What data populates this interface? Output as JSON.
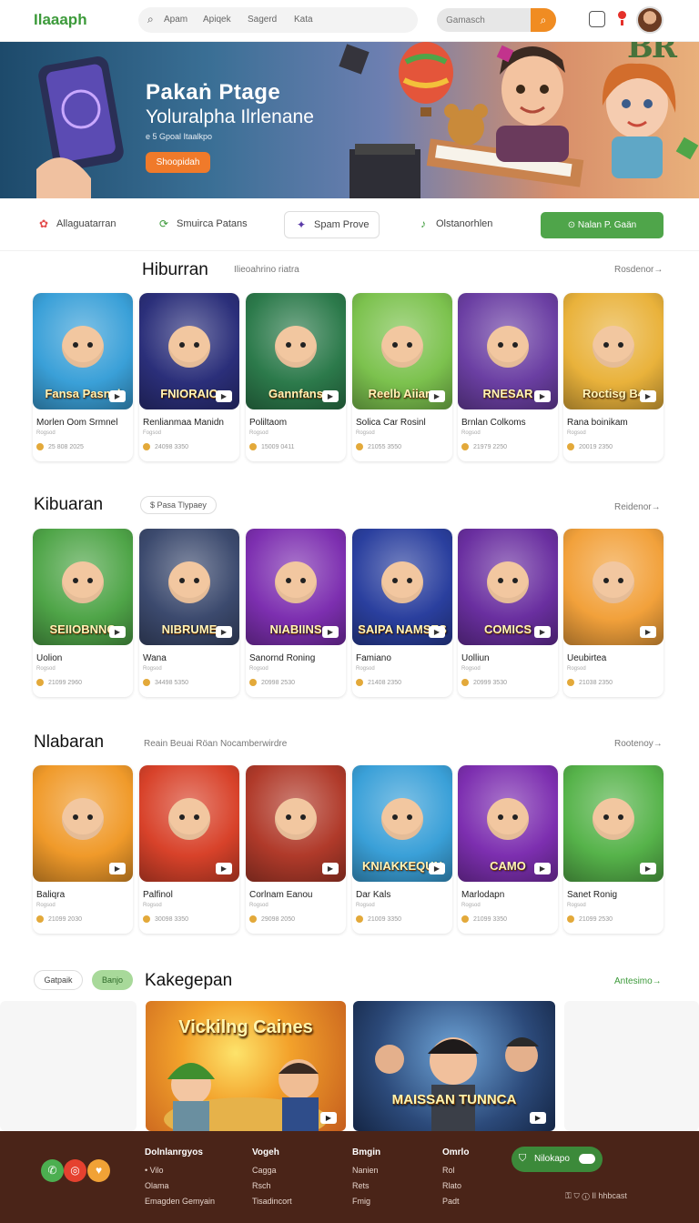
{
  "header": {
    "logo": "Ilaaaph",
    "nav": [
      "Apam",
      "Apiqek",
      "Sagerd",
      "Kata"
    ],
    "search_placeholder": "Gamasch"
  },
  "hero": {
    "title": "Pakaṅ Ptage",
    "subtitle": "Yoluralpha Ilrlenane",
    "small": "e 5 Gpoal Itaalkpo",
    "cta": "Shoopidah",
    "watermark": "BR"
  },
  "quickbar": {
    "items": [
      "Allaguatarran",
      "Smuirca Patans",
      "Spam Prove",
      "Olstanorhlen"
    ],
    "button": "Nalan P. Gaän"
  },
  "sections": [
    {
      "title": "Hiburran",
      "sub": "Ilieoahrino riatra",
      "more": "Rosdenor→",
      "cards": [
        {
          "name": "Morlen Oom Srmnel",
          "meta": "Rogsod",
          "price": "25 808 2025",
          "thumb_text": "Fansa Pasnal",
          "bg": "#3aa0d8"
        },
        {
          "name": "Renlianmaa Manidn",
          "meta": "Fogsod",
          "price": "24098 3350",
          "thumb_text": "FNIORAIO",
          "bg": "#2b2f7a"
        },
        {
          "name": "Poliltaom",
          "meta": "Rogsod",
          "price": "15009 0411",
          "thumb_text": "Gannfans",
          "bg": "#2c7a4b"
        },
        {
          "name": "Solica Car Rosinl",
          "meta": "Rogsod",
          "price": "21055 3550",
          "thumb_text": "Reelb Aiiara",
          "bg": "#7cc24e"
        },
        {
          "name": "Brnlan Colkoms",
          "meta": "Rogsod",
          "price": "21979 2250",
          "thumb_text": "RNESAR",
          "bg": "#6b3fa3"
        },
        {
          "name": "Rana boinikam",
          "meta": "Rogsod",
          "price": "20019 2350",
          "thumb_text": "Roctisg B4",
          "bg": "#e9b23b"
        }
      ]
    },
    {
      "title": "Kibuaran",
      "pill": "$ Pasa Tlypaey",
      "more": "Reidenor→",
      "cards": [
        {
          "name": "Uolion",
          "meta": "Rogsod",
          "price": "21099 2960",
          "thumb_text": "SEIIOBNNG",
          "bg": "#4fa548"
        },
        {
          "name": "Wana",
          "meta": "Rogsod",
          "price": "34498 5350",
          "thumb_text": "NIBRUME",
          "bg": "#3c4a6e"
        },
        {
          "name": "Sanornd Roning",
          "meta": "Rogsod",
          "price": "20998 2530",
          "thumb_text": "NIABIINS",
          "bg": "#7d2fb0"
        },
        {
          "name": "Famiano",
          "meta": "Rogsod",
          "price": "21408 2350",
          "thumb_text": "SAIPA NAMSES",
          "bg": "#2a3f9e"
        },
        {
          "name": "Uolliun",
          "meta": "Rogsod",
          "price": "20999 3530",
          "thumb_text": "COMICS",
          "bg": "#6a2fa0"
        },
        {
          "name": "Ueubirtea",
          "meta": "Rogsod",
          "price": "21038 2350",
          "thumb_text": "",
          "bg": "#f2a13b"
        }
      ]
    },
    {
      "title": "Nlabaran",
      "sub": "Reain Beuai Röan   Nocamberwirdre",
      "more": "Rootenoy→",
      "cards": [
        {
          "name": "Baliqra",
          "meta": "Rogsod",
          "price": "21099 2030",
          "thumb_text": "",
          "bg": "#f09a2a"
        },
        {
          "name": "Palfinol",
          "meta": "Rogsod",
          "price": "30098 3350",
          "thumb_text": "",
          "bg": "#d8422a"
        },
        {
          "name": "Corlnam Eanou",
          "meta": "Rogsod",
          "price": "29098 2050",
          "thumb_text": "",
          "bg": "#b03a2a"
        },
        {
          "name": "Dar Kals",
          "meta": "Rogsod",
          "price": "21009 3350",
          "thumb_text": "KNIAKKEQUN",
          "bg": "#3aa0d8"
        },
        {
          "name": "Marlodapn",
          "meta": "Rogsod",
          "price": "21099 3350",
          "thumb_text": "CAMO",
          "bg": "#7d2fb0"
        },
        {
          "name": "Sanet Ronig",
          "meta": "Rogsod",
          "price": "21099 2530",
          "thumb_text": "",
          "bg": "#56b34a"
        }
      ]
    }
  ],
  "bottom": {
    "pill1": "Gatpaik",
    "pill2": "Banjo",
    "title": "Kakegepan",
    "more": "Antesimo→",
    "cards": [
      {
        "label": "Vickilng Caines",
        "bg": "#f2a02b"
      },
      {
        "label": "MAISSAN TUNNCA",
        "bg": "#2c4a7a"
      }
    ]
  },
  "footer": {
    "cols": [
      {
        "title": "Dolnlanrgyos",
        "links": [
          "• Vilo",
          "Olama",
          "Emagden Gemyain"
        ]
      },
      {
        "title": "Vogeh",
        "links": [
          "Cagga",
          "Rsch",
          "Tisadincort"
        ]
      },
      {
        "title": "Bmgin",
        "links": [
          "Nanien",
          "Rets",
          "Fmig"
        ]
      },
      {
        "title": "Omrlo",
        "links": [
          "Rol",
          "Rlato",
          "Padt"
        ]
      }
    ],
    "toggle": "Nilokapo",
    "bottom_text": "Il hhbcast"
  }
}
